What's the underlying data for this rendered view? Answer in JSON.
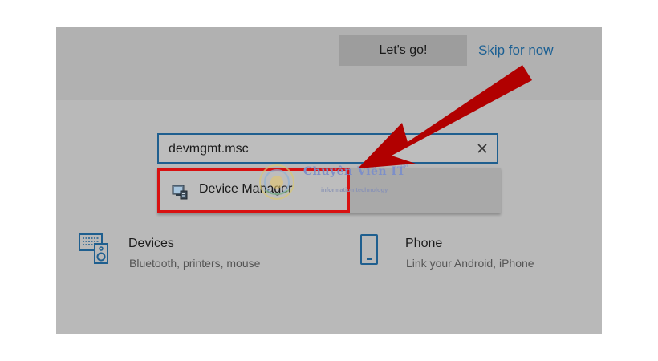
{
  "header": {
    "primary_button": "Let's go!",
    "secondary_link": "Skip for now"
  },
  "search": {
    "value": "devmgmt.msc",
    "placeholder": "",
    "clear_icon": "close-icon"
  },
  "results": [
    {
      "label": "Device Manager",
      "icon": "device-manager-icon",
      "highlighted": true
    }
  ],
  "watermark": {
    "title": "Chuyên Viên IT",
    "trademark": "TM",
    "subtitle": "information technology"
  },
  "tiles": [
    {
      "title": "Devices",
      "description": "Bluetooth, printers, mouse",
      "icon": "devices-icon"
    },
    {
      "title": "Phone",
      "description": "Link your Android, iPhone",
      "icon": "phone-icon"
    }
  ],
  "colors": {
    "accent": "#1f5f8f",
    "highlight_border": "#d81111",
    "arrow": "#b10000",
    "overlay": "#b9b9b9"
  }
}
